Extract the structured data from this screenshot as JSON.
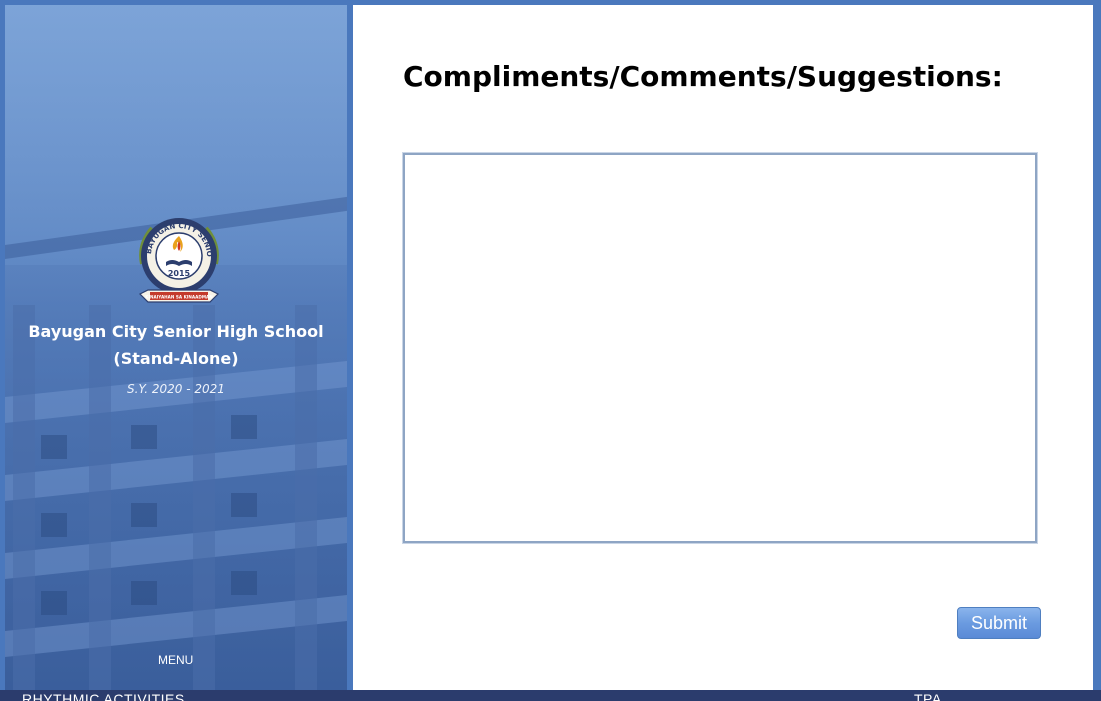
{
  "sidebar": {
    "school_name_line1": "Bayugan City Senior High School",
    "school_name_line2": "(Stand-Alone)",
    "school_year": "S.Y. 2020 - 2021",
    "menu_label": "MENU",
    "logo": {
      "ring_text": "BAYUGAN CITY SENIOR HIGH SCHOOL",
      "year": "2015",
      "banner_text": "KINAIYAHAN SA KINAADMAN",
      "icon": "school-seal-icon"
    }
  },
  "main": {
    "heading": "Compliments/Comments/Suggestions:",
    "comment_value": "",
    "submit_label": "Submit"
  },
  "bottom_strip": {
    "left_text": "RHYTHMIC ACTIVITIES",
    "right_text": "TPA"
  },
  "colors": {
    "frame": "#4a78bd",
    "panel": "#ffffff",
    "button": "#6b9be0",
    "sidebar_overlay": "#5f88c4"
  }
}
